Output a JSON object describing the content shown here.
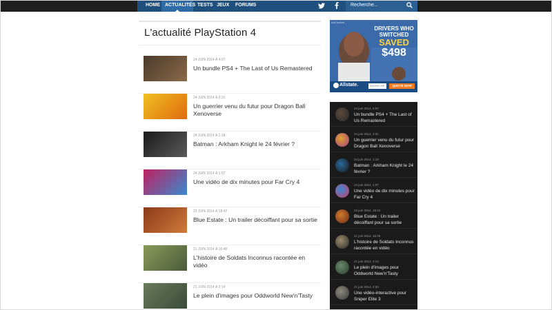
{
  "nav": {
    "items": [
      {
        "label": "Home"
      },
      {
        "label": "Actualités"
      },
      {
        "label": "Tests"
      },
      {
        "label": "Jeux"
      },
      {
        "label": "Forums"
      }
    ],
    "active_index": 1,
    "social": [
      "twitter-icon",
      "facebook-icon"
    ],
    "search_placeholder": "Recherche..."
  },
  "page_title": "L'actualité PlayStation 4",
  "articles": [
    {
      "meta": "24 juin 2014 à 4:07",
      "title": "Un bundle PS4 + The Last of Us Remastered",
      "colors": [
        "#4a3a2a",
        "#8a6a4a"
      ]
    },
    {
      "meta": "24 juin 2014 à 3:31",
      "title": "Un guerrier venu du futur pour Dragon Ball Xenoverse",
      "colors": [
        "#f0c020",
        "#e06a10"
      ]
    },
    {
      "meta": "24 juin 2014 à 1:18",
      "title": "Batman : Arkham Knight le 24 février ?",
      "colors": [
        "#1a1a1a",
        "#5a5a5a"
      ]
    },
    {
      "meta": "24 juin 2014 à 1:07",
      "title": "Une vidéo de dix minutes pour Far Cry 4",
      "colors": [
        "#c02060",
        "#3a8ad0"
      ]
    },
    {
      "meta": "22 juin 2014 à 18:42",
      "title": "Blue Estate : Un trailer décoiffant pour sa sortie",
      "colors": [
        "#8a3a1a",
        "#d07a3a"
      ]
    },
    {
      "meta": "21 juin 2014 à 16:48",
      "title": "L'histoire de Soldats Inconnus racontée en vidéo",
      "colors": [
        "#8a9a5a",
        "#4a5a3a"
      ]
    },
    {
      "meta": "21 juin 2014 à 3:14",
      "title": "Le plein d'images pour Oddworld New'n'Tasty",
      "colors": [
        "#6a7a5a",
        "#3a4a3a"
      ]
    }
  ],
  "ad": {
    "line1": "DRIVERS WHO SWITCHED",
    "line2": "SAVED",
    "line3": "$498",
    "brand": "Allstate.",
    "zip_label": "ENTER ZIP",
    "cta": "QUOTE NOW",
    "tag": "AdChoices"
  },
  "sidebar_news": [
    {
      "meta": "24 juin 2014, 4:07",
      "title": "Un bundle PS4 + The Last of Us Remastered",
      "colors": [
        "#5a4a3a",
        "#2a2a2a"
      ]
    },
    {
      "meta": "24 juin 2014, 3:31",
      "title": "Un guerrier venu du futur pour Dragon Ball Xenoverse",
      "colors": [
        "#e0a030",
        "#a04080"
      ]
    },
    {
      "meta": "24 juin 2014, 1:18",
      "title": "Batman : Arkham Knight le 24 février ?",
      "colors": [
        "#2a6a9a",
        "#1a1a1a"
      ]
    },
    {
      "meta": "24 juin 2014, 1:07",
      "title": "Une vidéo de dix minutes pour Far Cry 4",
      "colors": [
        "#3a8ad0",
        "#d03a6a"
      ]
    },
    {
      "meta": "22 juin 2014, 18:42",
      "title": "Blue Estate : Un trailer décoiffant pour sa sortie",
      "colors": [
        "#d07a2a",
        "#6a2a1a"
      ]
    },
    {
      "meta": "21 juin 2014, 16:48",
      "title": "L'histoire de Soldats Inconnus racontée en vidéo",
      "colors": [
        "#9a8a6a",
        "#2a2a2a"
      ]
    },
    {
      "meta": "21 juin 2014, 3:14",
      "title": "Le plein d'images pour Oddworld New'n'Tasty",
      "colors": [
        "#6a8a6a",
        "#2a3a2a"
      ]
    },
    {
      "meta": "21 juin 2014, 2:30",
      "title": "Une vidéo-interactive pour Sniper Elite 3",
      "colors": [
        "#8a8a7a",
        "#3a3a3a"
      ]
    }
  ],
  "colors": {
    "nav_bg": "#1f4f7d",
    "nav_active": "#2d6aa6",
    "sidebar_bg": "#1a1a1a"
  }
}
